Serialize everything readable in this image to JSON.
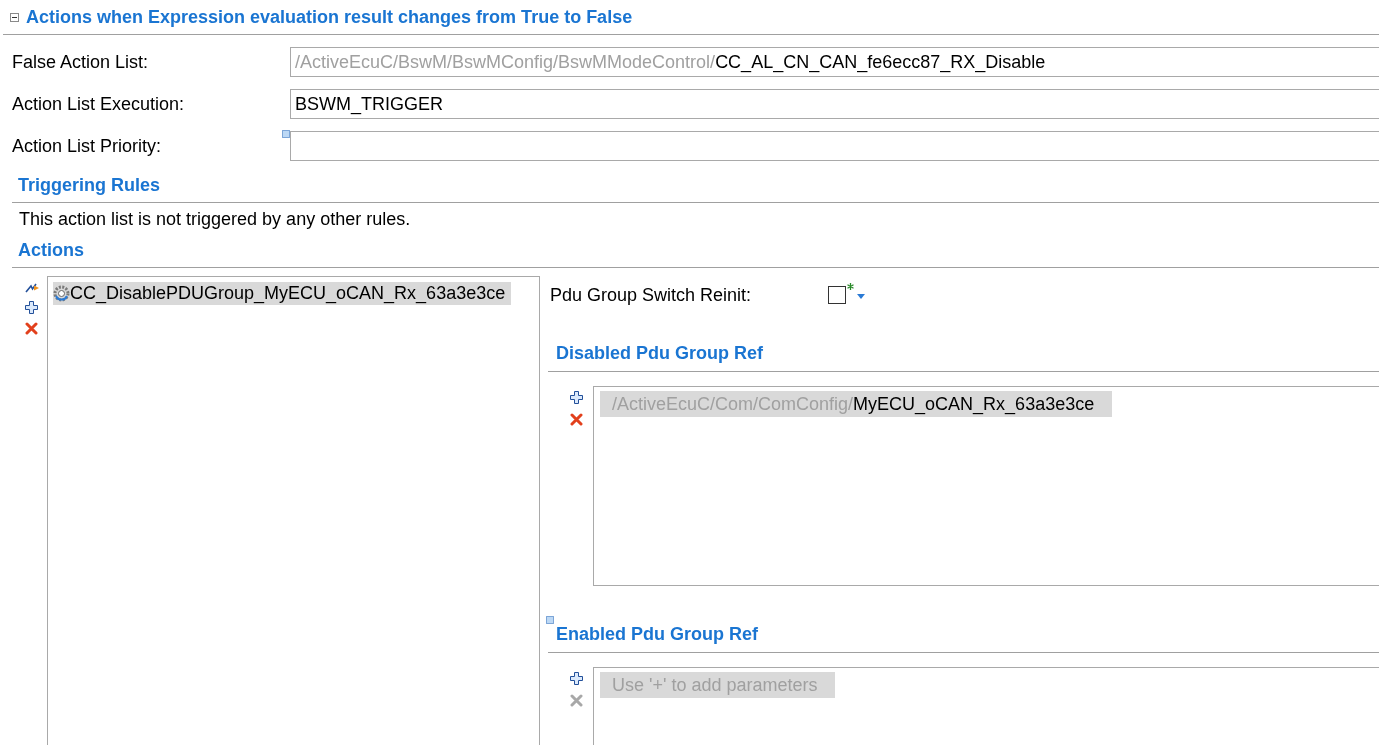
{
  "section": {
    "title": "Actions when Expression evaluation result changes from True to False",
    "expanded": true
  },
  "fields": [
    {
      "kind": "reference",
      "label": "False Action List:",
      "path": "/ActiveEcuC/BswM/BswMConfig/BswMModeControl/",
      "value": "CC_AL_CN_CAN_fe6ecc87_RX_Disable",
      "marked": false
    },
    {
      "kind": "text",
      "label": "Action List Execution:",
      "value": "BSWM_TRIGGER",
      "marked": false
    },
    {
      "kind": "text",
      "label": "Action List Priority:",
      "marked": true
    }
  ],
  "triggering_rules": {
    "title": "Triggering Rules",
    "message": "This action list is not triggered by any other rules."
  },
  "actions": {
    "title": "Actions",
    "toolbar": [
      {
        "kind": "wizard",
        "disabled": false
      },
      {
        "kind": "add",
        "disabled": false
      },
      {
        "kind": "remove",
        "disabled": false
      }
    ],
    "items": [
      {
        "label": "CC_DisablePDUGroup_MyECU_oCAN_Rx_63a3e3ce",
        "selected": true
      }
    ]
  },
  "action_details": {
    "pdu_group_switch_reinit": {
      "label": "Pdu Group Switch Reinit:",
      "checked": false
    },
    "ref_lists": [
      {
        "title": "Disabled Pdu Group Ref",
        "marked": false,
        "toolbar": [
          {
            "kind": "add",
            "disabled": false
          },
          {
            "kind": "remove",
            "disabled": false
          }
        ],
        "items": [
          {
            "path": "/ActiveEcuC/Com/ComConfig/",
            "value": "MyECU_oCAN_Rx_63a3e3ce",
            "selected": true
          }
        ]
      },
      {
        "title": "Enabled Pdu Group Ref",
        "marked": true,
        "toolbar": [
          {
            "kind": "add",
            "disabled": false
          },
          {
            "kind": "remove",
            "disabled": true
          }
        ],
        "placeholder": "Use '+' to add parameters"
      }
    ]
  }
}
